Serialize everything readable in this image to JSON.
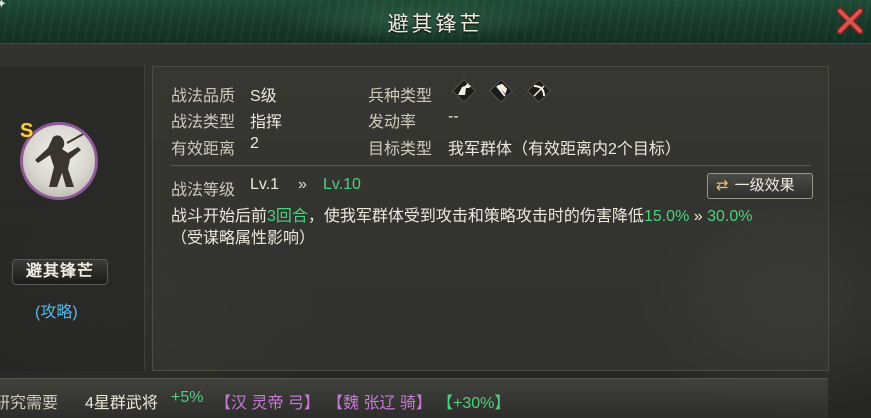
{
  "header": {
    "title": "避其锋芒",
    "close_icon": "close-x-icon"
  },
  "colors": {
    "accent_green": "#4fd07e",
    "quality_purple": "#8e5a97",
    "link_blue": "#56b6e8",
    "header_green": "#1f4a37",
    "close_red": "#d9534f"
  },
  "tactic": {
    "quality_badge": "S",
    "name": "避其锋芒",
    "type_tag": "(攻略)"
  },
  "info": {
    "quality_label": "战法品质",
    "quality_value": "S级",
    "type_label": "战法类型",
    "type_value": "指挥",
    "range_label": "有效距离",
    "range_value": "2",
    "troop_label": "兵种类型",
    "troop_icons": [
      "cavalry-icon",
      "shield-icon",
      "bow-icon"
    ],
    "rate_label": "发动率",
    "rate_value": "--",
    "target_label": "目标类型",
    "target_value": "我军群体（有效距离内2个目标）"
  },
  "level": {
    "label": "战法等级",
    "from": "Lv.1",
    "arrow": "»",
    "to": "Lv.10",
    "effect_button": "一级效果"
  },
  "description": {
    "part1": "战斗开始后前",
    "turns": "3回合",
    "part2": "，使我军群体受到攻击和策略攻击时的伤害降低",
    "value_from": "15.0%",
    "arrow": "»",
    "value_to": "30.0%",
    "line2": "（受谋略属性影响）"
  },
  "bottom": {
    "label": "研究需要",
    "req1": "4星群武将",
    "req1_bonus": "+5%",
    "req2": "【汉 灵帝 弓】",
    "req3": "【魏 张辽 骑】",
    "req3_bonus": "【+30%】"
  }
}
